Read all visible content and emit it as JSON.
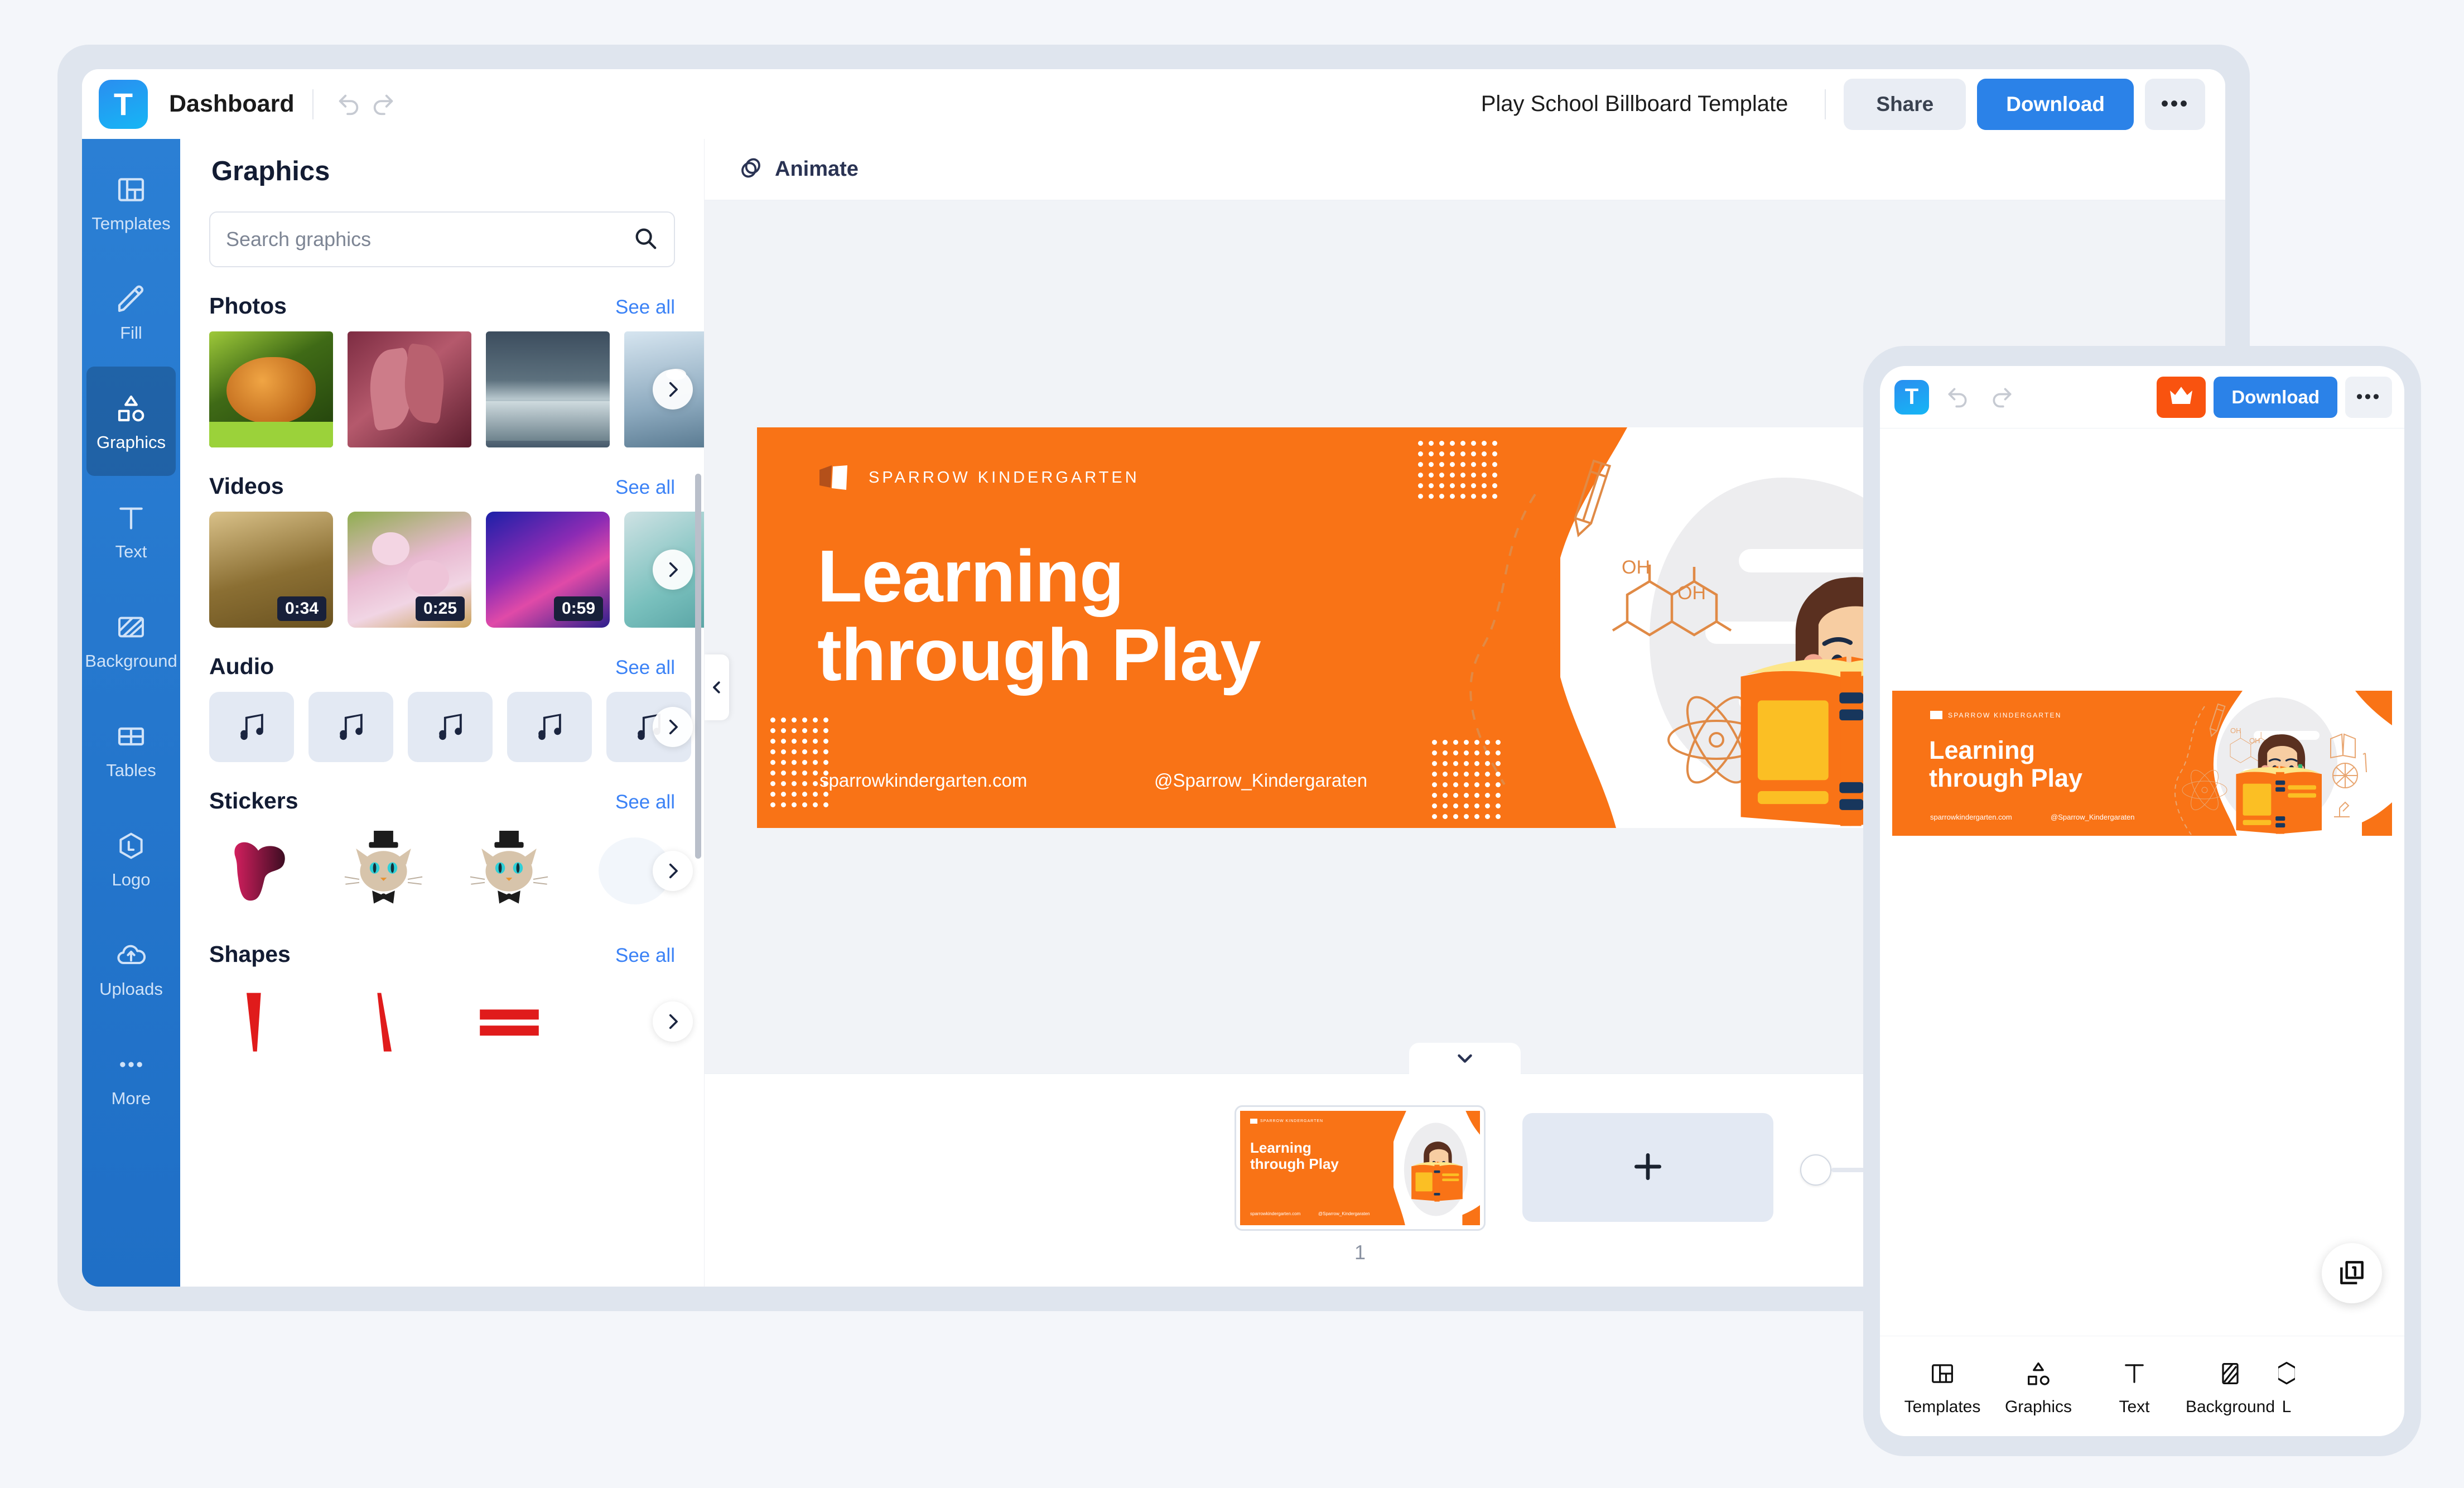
{
  "app": {
    "logo_letter": "T",
    "dashboard_label": "Dashboard",
    "undo_icon": "undo-icon",
    "redo_icon": "redo-icon"
  },
  "header": {
    "doc_title": "Play School Billboard Template",
    "share_label": "Share",
    "download_label": "Download",
    "more_label": "•••"
  },
  "rail": {
    "items": [
      {
        "label": "Templates",
        "icon": "templates-icon",
        "active": false
      },
      {
        "label": "Fill",
        "icon": "pen-fill-icon",
        "active": false
      },
      {
        "label": "Graphics",
        "icon": "graphics-shapes-icon",
        "active": true
      },
      {
        "label": "Text",
        "icon": "text-t-icon",
        "active": false
      },
      {
        "label": "Background",
        "icon": "background-icon",
        "active": false
      },
      {
        "label": "Tables",
        "icon": "tables-icon",
        "active": false
      },
      {
        "label": "Logo",
        "icon": "logo-hexagon-icon",
        "active": false
      },
      {
        "label": "Uploads",
        "icon": "upload-cloud-icon",
        "active": false
      },
      {
        "label": "More",
        "icon": "ellipsis-icon",
        "active": false
      }
    ]
  },
  "panel": {
    "title": "Graphics",
    "search_placeholder": "Search graphics",
    "search_value": "",
    "search_icon": "search-icon",
    "see_all_label": "See all",
    "sections": [
      {
        "title": "Photos",
        "kind": "photos",
        "items": [
          {
            "name": "squirrel-photo",
            "c1": "#8bbd2e",
            "c2": "#2f5a13",
            "c3": "#e08b2a"
          },
          {
            "name": "pink-leaves-photo",
            "c1": "#9c3b52",
            "c2": "#d4737f",
            "c3": "#5d2133"
          },
          {
            "name": "stormy-sea-photo",
            "c1": "#38495a",
            "c2": "#9fb2bd",
            "c3": "#1e2b38"
          },
          {
            "name": "dragonfly-photo",
            "c1": "#c2d6e6",
            "c2": "#8fa8bd",
            "c3": "#e3edf5"
          }
        ]
      },
      {
        "title": "Videos",
        "kind": "videos",
        "items": [
          {
            "name": "forest-light-video",
            "duration": "0:34",
            "c1": "#b79a5d",
            "c2": "#6a5424",
            "c3": "#e0cc95"
          },
          {
            "name": "cherry-blossom-video",
            "duration": "0:25",
            "c1": "#e6a8c4",
            "c2": "#7fa046",
            "c3": "#f4d3e2"
          },
          {
            "name": "ink-swirl-video",
            "duration": "0:59",
            "c1": "#2b2ea8",
            "c2": "#d33fa1",
            "c3": "#6a25a8"
          },
          {
            "name": "turquoise-shore-video",
            "duration": "",
            "c1": "#7cc3c0",
            "c2": "#cfe2e4",
            "c3": "#4e9a9c"
          }
        ]
      },
      {
        "title": "Audio",
        "kind": "audio",
        "items": [
          {
            "name": "audio-track-1",
            "icon": "music-note-icon"
          },
          {
            "name": "audio-track-2",
            "icon": "music-note-icon"
          },
          {
            "name": "audio-track-3",
            "icon": "music-note-icon"
          },
          {
            "name": "audio-track-4",
            "icon": "music-note-icon"
          },
          {
            "name": "audio-track-5",
            "icon": "music-note-icon"
          }
        ]
      },
      {
        "title": "Stickers",
        "kind": "stickers",
        "items": [
          {
            "name": "magenta-blob-sticker",
            "type": "blob"
          },
          {
            "name": "cat-tophat-sticker-1",
            "type": "cat"
          },
          {
            "name": "cat-tophat-sticker-2",
            "type": "cat"
          },
          {
            "name": "faded-sticker",
            "type": "faded"
          }
        ]
      },
      {
        "title": "Shapes",
        "kind": "shapes",
        "items": [
          {
            "name": "red-wedge-shape",
            "type": "wedge-left"
          },
          {
            "name": "red-slash-shape",
            "type": "wedge-right"
          },
          {
            "name": "red-equals-shape",
            "type": "equals"
          },
          {
            "name": "shape-more",
            "type": "blank"
          }
        ]
      }
    ]
  },
  "canvas": {
    "animate_label": "Animate",
    "animate_icon": "animate-rings-icon",
    "collapse_left_icon": "chevron-left-icon",
    "tray_collapse_icon": "chevron-down-icon",
    "add_page_icon": "plus-icon",
    "page_number": "1",
    "zoom_knob_position_pct": 8
  },
  "design": {
    "brand_name": "SPARROW KINDERGARTEN",
    "headline_line1": "Learning",
    "headline_line2": "through Play",
    "website": "sparrowkindergarten.com",
    "handle": "@Sparrow_Kindergaraten",
    "colors": {
      "orange": "#f97316",
      "orange_dark": "#d95c0a",
      "book_yellow": "#fbbf24",
      "hair_brown": "#5a3020",
      "skin": "#f7cda2",
      "navy": "#17365c",
      "grey_blob": "#ededef"
    },
    "doodles": [
      "pencil-doodle",
      "molecule-OH-doodle",
      "atom-doodle",
      "book-doodle",
      "basketball-doodle",
      "microscope-doodle"
    ],
    "doodle_labels": [
      "OH",
      "OH"
    ]
  },
  "mobile": {
    "logo_letter": "T",
    "undo_icon": "undo-icon",
    "redo_icon": "redo-icon",
    "crown_icon": "crown-premium-icon",
    "download_label": "Download",
    "more_label": "•••",
    "pages_icon": "pages-stack-icon",
    "bottom_nav": [
      {
        "label": "Templates",
        "icon": "templates-icon"
      },
      {
        "label": "Graphics",
        "icon": "graphics-shapes-icon"
      },
      {
        "label": "Text",
        "icon": "text-t-icon"
      },
      {
        "label": "Background",
        "icon": "background-icon"
      },
      {
        "label": "L",
        "icon": "logo-hexagon-icon"
      }
    ]
  }
}
